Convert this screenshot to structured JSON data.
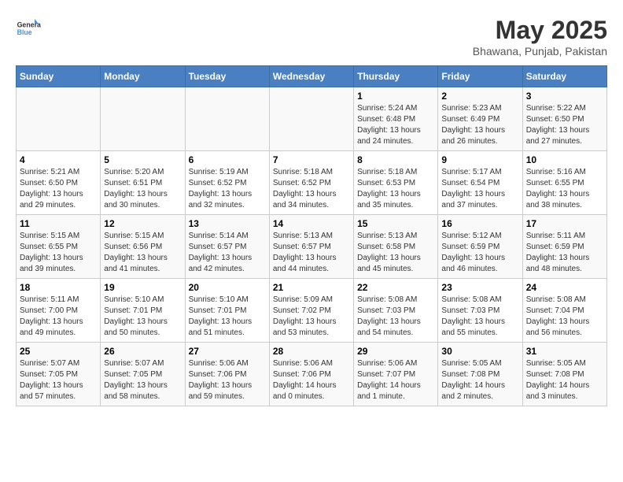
{
  "header": {
    "logo_general": "General",
    "logo_blue": "Blue",
    "month_title": "May 2025",
    "location": "Bhawana, Punjab, Pakistan"
  },
  "days_of_week": [
    "Sunday",
    "Monday",
    "Tuesday",
    "Wednesday",
    "Thursday",
    "Friday",
    "Saturday"
  ],
  "weeks": [
    [
      {
        "day": "",
        "info": ""
      },
      {
        "day": "",
        "info": ""
      },
      {
        "day": "",
        "info": ""
      },
      {
        "day": "",
        "info": ""
      },
      {
        "day": "1",
        "info": "Sunrise: 5:24 AM\nSunset: 6:48 PM\nDaylight: 13 hours\nand 24 minutes."
      },
      {
        "day": "2",
        "info": "Sunrise: 5:23 AM\nSunset: 6:49 PM\nDaylight: 13 hours\nand 26 minutes."
      },
      {
        "day": "3",
        "info": "Sunrise: 5:22 AM\nSunset: 6:50 PM\nDaylight: 13 hours\nand 27 minutes."
      }
    ],
    [
      {
        "day": "4",
        "info": "Sunrise: 5:21 AM\nSunset: 6:50 PM\nDaylight: 13 hours\nand 29 minutes."
      },
      {
        "day": "5",
        "info": "Sunrise: 5:20 AM\nSunset: 6:51 PM\nDaylight: 13 hours\nand 30 minutes."
      },
      {
        "day": "6",
        "info": "Sunrise: 5:19 AM\nSunset: 6:52 PM\nDaylight: 13 hours\nand 32 minutes."
      },
      {
        "day": "7",
        "info": "Sunrise: 5:18 AM\nSunset: 6:52 PM\nDaylight: 13 hours\nand 34 minutes."
      },
      {
        "day": "8",
        "info": "Sunrise: 5:18 AM\nSunset: 6:53 PM\nDaylight: 13 hours\nand 35 minutes."
      },
      {
        "day": "9",
        "info": "Sunrise: 5:17 AM\nSunset: 6:54 PM\nDaylight: 13 hours\nand 37 minutes."
      },
      {
        "day": "10",
        "info": "Sunrise: 5:16 AM\nSunset: 6:55 PM\nDaylight: 13 hours\nand 38 minutes."
      }
    ],
    [
      {
        "day": "11",
        "info": "Sunrise: 5:15 AM\nSunset: 6:55 PM\nDaylight: 13 hours\nand 39 minutes."
      },
      {
        "day": "12",
        "info": "Sunrise: 5:15 AM\nSunset: 6:56 PM\nDaylight: 13 hours\nand 41 minutes."
      },
      {
        "day": "13",
        "info": "Sunrise: 5:14 AM\nSunset: 6:57 PM\nDaylight: 13 hours\nand 42 minutes."
      },
      {
        "day": "14",
        "info": "Sunrise: 5:13 AM\nSunset: 6:57 PM\nDaylight: 13 hours\nand 44 minutes."
      },
      {
        "day": "15",
        "info": "Sunrise: 5:13 AM\nSunset: 6:58 PM\nDaylight: 13 hours\nand 45 minutes."
      },
      {
        "day": "16",
        "info": "Sunrise: 5:12 AM\nSunset: 6:59 PM\nDaylight: 13 hours\nand 46 minutes."
      },
      {
        "day": "17",
        "info": "Sunrise: 5:11 AM\nSunset: 6:59 PM\nDaylight: 13 hours\nand 48 minutes."
      }
    ],
    [
      {
        "day": "18",
        "info": "Sunrise: 5:11 AM\nSunset: 7:00 PM\nDaylight: 13 hours\nand 49 minutes."
      },
      {
        "day": "19",
        "info": "Sunrise: 5:10 AM\nSunset: 7:01 PM\nDaylight: 13 hours\nand 50 minutes."
      },
      {
        "day": "20",
        "info": "Sunrise: 5:10 AM\nSunset: 7:01 PM\nDaylight: 13 hours\nand 51 minutes."
      },
      {
        "day": "21",
        "info": "Sunrise: 5:09 AM\nSunset: 7:02 PM\nDaylight: 13 hours\nand 53 minutes."
      },
      {
        "day": "22",
        "info": "Sunrise: 5:08 AM\nSunset: 7:03 PM\nDaylight: 13 hours\nand 54 minutes."
      },
      {
        "day": "23",
        "info": "Sunrise: 5:08 AM\nSunset: 7:03 PM\nDaylight: 13 hours\nand 55 minutes."
      },
      {
        "day": "24",
        "info": "Sunrise: 5:08 AM\nSunset: 7:04 PM\nDaylight: 13 hours\nand 56 minutes."
      }
    ],
    [
      {
        "day": "25",
        "info": "Sunrise: 5:07 AM\nSunset: 7:05 PM\nDaylight: 13 hours\nand 57 minutes."
      },
      {
        "day": "26",
        "info": "Sunrise: 5:07 AM\nSunset: 7:05 PM\nDaylight: 13 hours\nand 58 minutes."
      },
      {
        "day": "27",
        "info": "Sunrise: 5:06 AM\nSunset: 7:06 PM\nDaylight: 13 hours\nand 59 minutes."
      },
      {
        "day": "28",
        "info": "Sunrise: 5:06 AM\nSunset: 7:06 PM\nDaylight: 14 hours\nand 0 minutes."
      },
      {
        "day": "29",
        "info": "Sunrise: 5:06 AM\nSunset: 7:07 PM\nDaylight: 14 hours\nand 1 minute."
      },
      {
        "day": "30",
        "info": "Sunrise: 5:05 AM\nSunset: 7:08 PM\nDaylight: 14 hours\nand 2 minutes."
      },
      {
        "day": "31",
        "info": "Sunrise: 5:05 AM\nSunset: 7:08 PM\nDaylight: 14 hours\nand 3 minutes."
      }
    ]
  ]
}
